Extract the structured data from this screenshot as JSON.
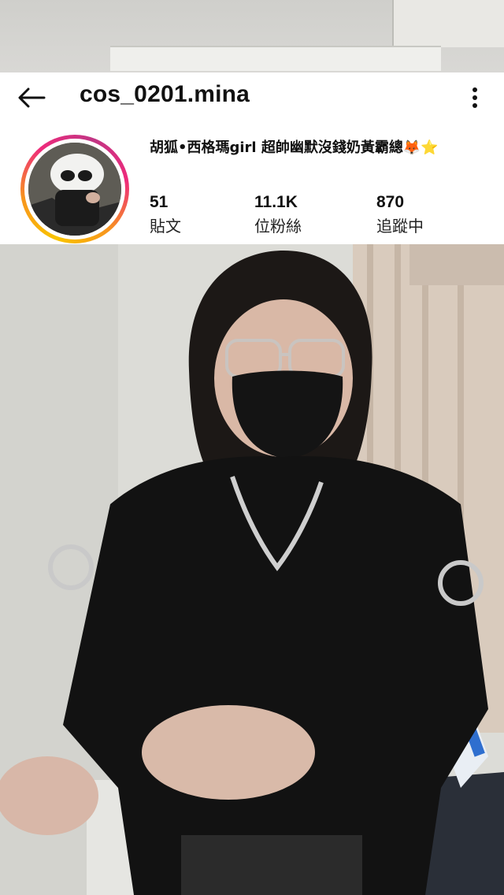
{
  "header": {
    "username": "cos_0201.mina",
    "back_icon": "arrow-left-icon",
    "more_icon": "more-vertical-icon"
  },
  "profile": {
    "bio": "胡狐•西格瑪girl 超帥幽默沒錢奶黃霸總🦊⭐",
    "avatar_ring_colors": [
      "#f9c400",
      "#f7941e",
      "#ee2a7b",
      "#c13584"
    ]
  },
  "stats": [
    {
      "value": "51",
      "label": "貼文"
    },
    {
      "value": "11.1K",
      "label": "位粉絲"
    },
    {
      "value": "870",
      "label": "追蹤中"
    }
  ]
}
